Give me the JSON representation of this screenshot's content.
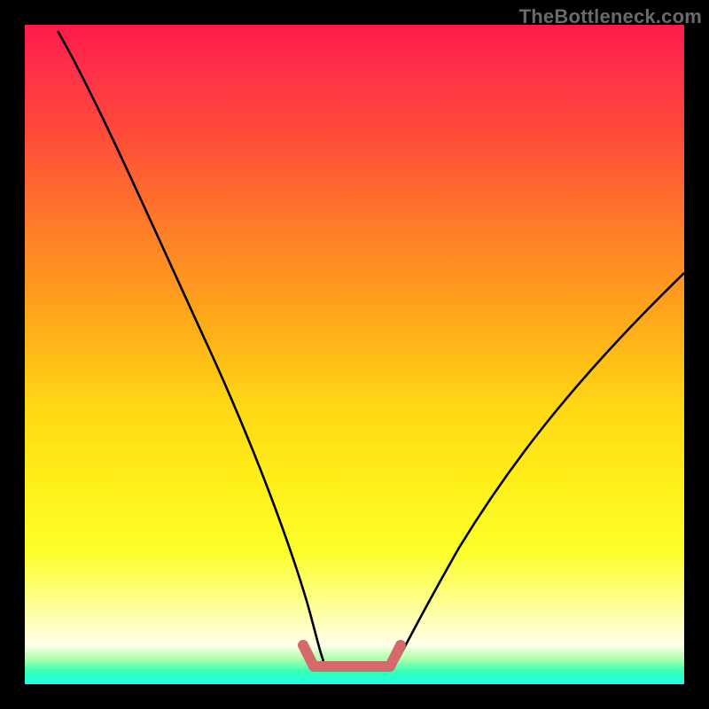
{
  "watermark": "TheBottleneck.com",
  "chart_data": {
    "type": "line",
    "title": "",
    "xlabel": "",
    "ylabel": "",
    "xlim": [
      0,
      100
    ],
    "ylim": [
      0,
      100
    ],
    "series": [
      {
        "name": "curve-left",
        "x": [
          5,
          10,
          15,
          20,
          25,
          30,
          35,
          40,
          42,
          44
        ],
        "values": [
          99,
          88,
          75,
          62,
          48,
          35,
          22,
          11,
          7,
          4
        ]
      },
      {
        "name": "curve-right",
        "x": [
          55,
          57,
          60,
          65,
          70,
          75,
          80,
          85,
          90,
          95,
          100
        ],
        "values": [
          4,
          6,
          9,
          15,
          22,
          29,
          36,
          43,
          50,
          56,
          62
        ]
      },
      {
        "name": "bracket",
        "x": [
          42,
          44,
          55,
          57
        ],
        "values": [
          7,
          2.5,
          2.5,
          6
        ]
      }
    ],
    "colors": {
      "curve": "#000000",
      "bracket": "#d46a6a"
    }
  }
}
